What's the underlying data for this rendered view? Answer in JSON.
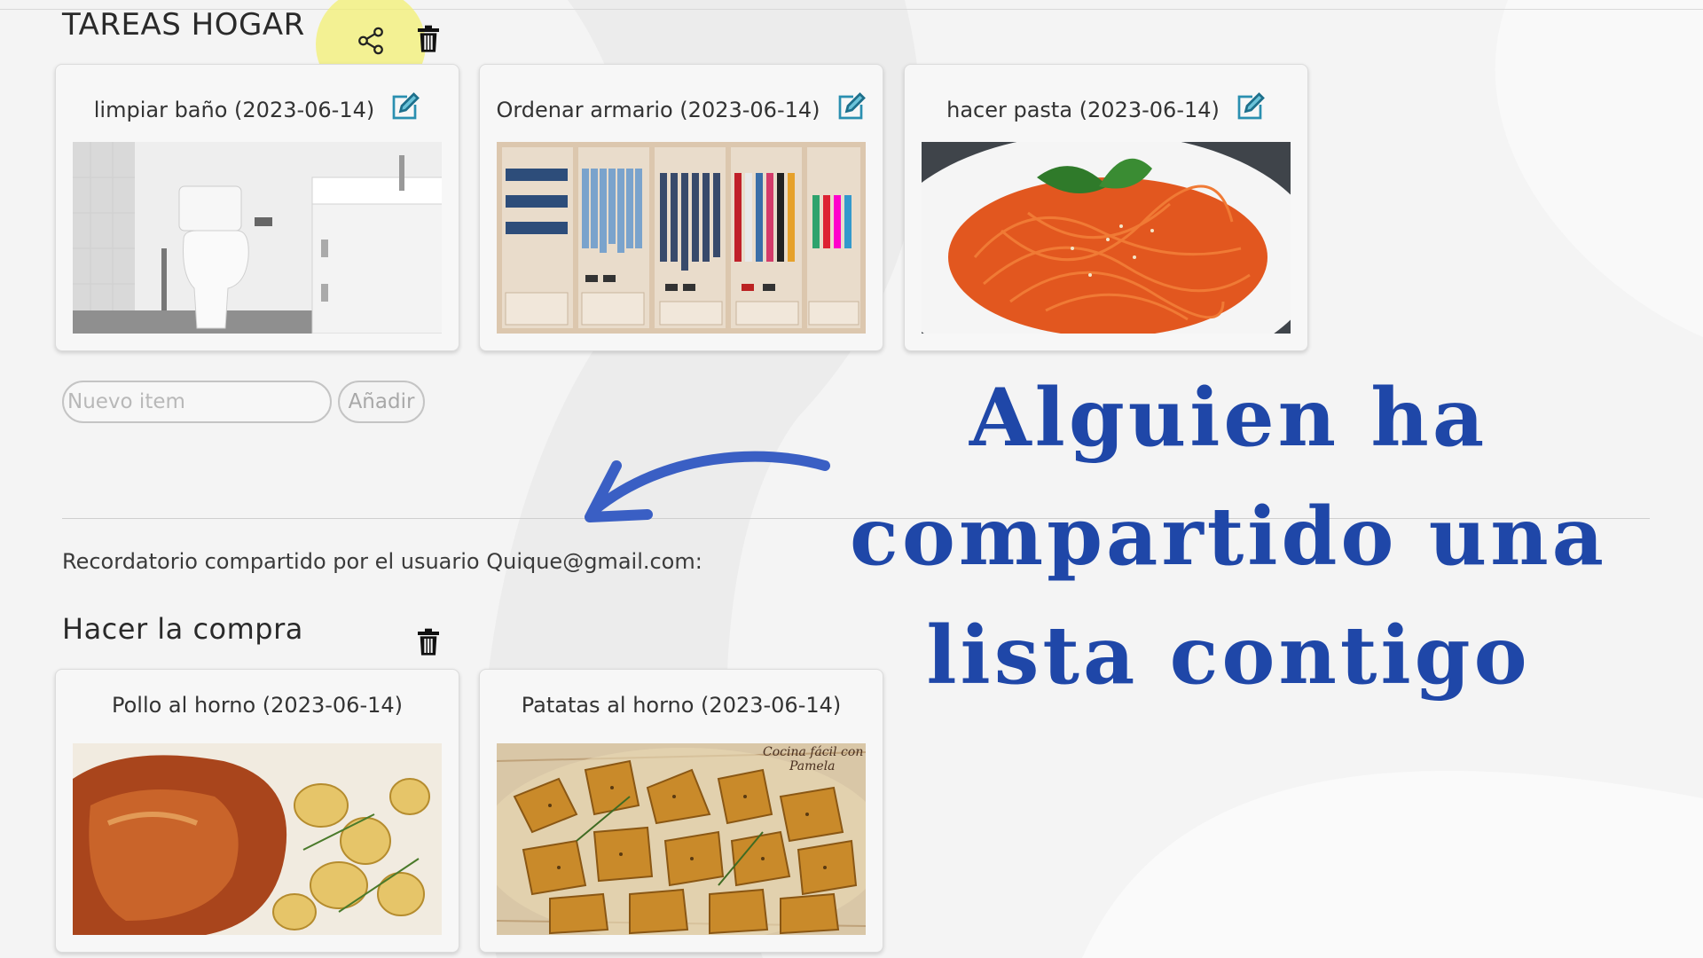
{
  "tareas_hogar": {
    "title": "TAREAS HOGAR",
    "share_icon": "share-icon",
    "delete_icon": "trash-icon",
    "items": [
      {
        "label": "limpiar baño (2023-06-14)",
        "edit_icon": "edit-pencil-icon",
        "image": "bathroom-photo"
      },
      {
        "label": "Ordenar armario (2023-06-14)",
        "edit_icon": "edit-pencil-icon",
        "image": "wardrobe-photo"
      },
      {
        "label": "hacer pasta (2023-06-14)",
        "edit_icon": "edit-pencil-icon",
        "image": "pasta-photo"
      }
    ],
    "new_item": {
      "placeholder": "Nuevo item",
      "value": ""
    },
    "add_button": "Añadir"
  },
  "shared_note": "Recordatorio compartido por el usuario Quique@gmail.com:",
  "hacer_la_compra": {
    "title": "Hacer la compra",
    "delete_icon": "trash-icon",
    "items": [
      {
        "label": "Pollo al horno (2023-06-14)",
        "image": "roast-chicken-photo"
      },
      {
        "label": "Patatas al horno (2023-06-14)",
        "image": "roast-potatoes-photo",
        "watermark": "Cocina fácil con Pamela"
      }
    ]
  },
  "overlay": {
    "line1": "Alguien ha",
    "line2": "compartido una",
    "line3": "lista contigo",
    "color": "#1f47a8"
  },
  "colors": {
    "highlight": "#f2f06e",
    "edit_icon": "#2a8fb0",
    "background": "#f4f4f4"
  }
}
